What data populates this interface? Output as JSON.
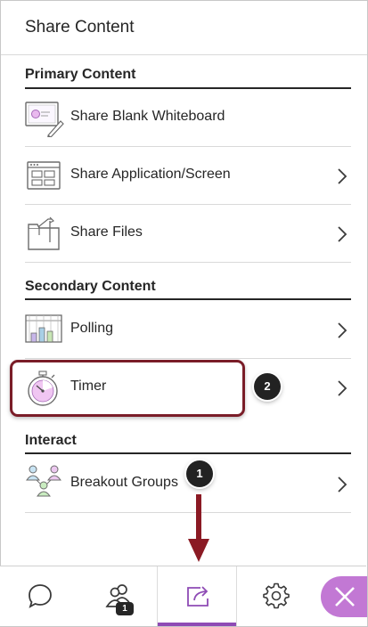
{
  "header": {
    "title": "Share Content"
  },
  "sections": {
    "primary": {
      "title": "Primary Content",
      "items": [
        {
          "label": "Share Blank Whiteboard",
          "icon": "whiteboard-icon",
          "has_chevron": false
        },
        {
          "label": "Share Application/Screen",
          "icon": "application-screen-icon",
          "has_chevron": true
        },
        {
          "label": "Share Files",
          "icon": "files-folder-icon",
          "has_chevron": true
        }
      ]
    },
    "secondary": {
      "title": "Secondary Content",
      "items": [
        {
          "label": "Polling",
          "icon": "polling-chart-icon",
          "has_chevron": true
        },
        {
          "label": "Timer",
          "icon": "stopwatch-icon",
          "has_chevron": true
        }
      ]
    },
    "interact": {
      "title": "Interact",
      "items": [
        {
          "label": "Breakout Groups",
          "icon": "breakout-groups-icon",
          "has_chevron": true
        }
      ]
    }
  },
  "callouts": {
    "step1": "1",
    "step2": "2"
  },
  "bottom_bar": {
    "tabs": [
      {
        "icon": "chat-bubble-icon"
      },
      {
        "icon": "attendees-icon",
        "badge": "1"
      },
      {
        "icon": "share-content-icon",
        "active": true
      },
      {
        "icon": "settings-gear-icon"
      }
    ],
    "close_icon": "close-x-icon"
  },
  "colors": {
    "accent": "#8e4bb5",
    "close_bg": "#c278d4",
    "highlight_border": "#7a1d28",
    "arrow": "#8b1a24"
  }
}
